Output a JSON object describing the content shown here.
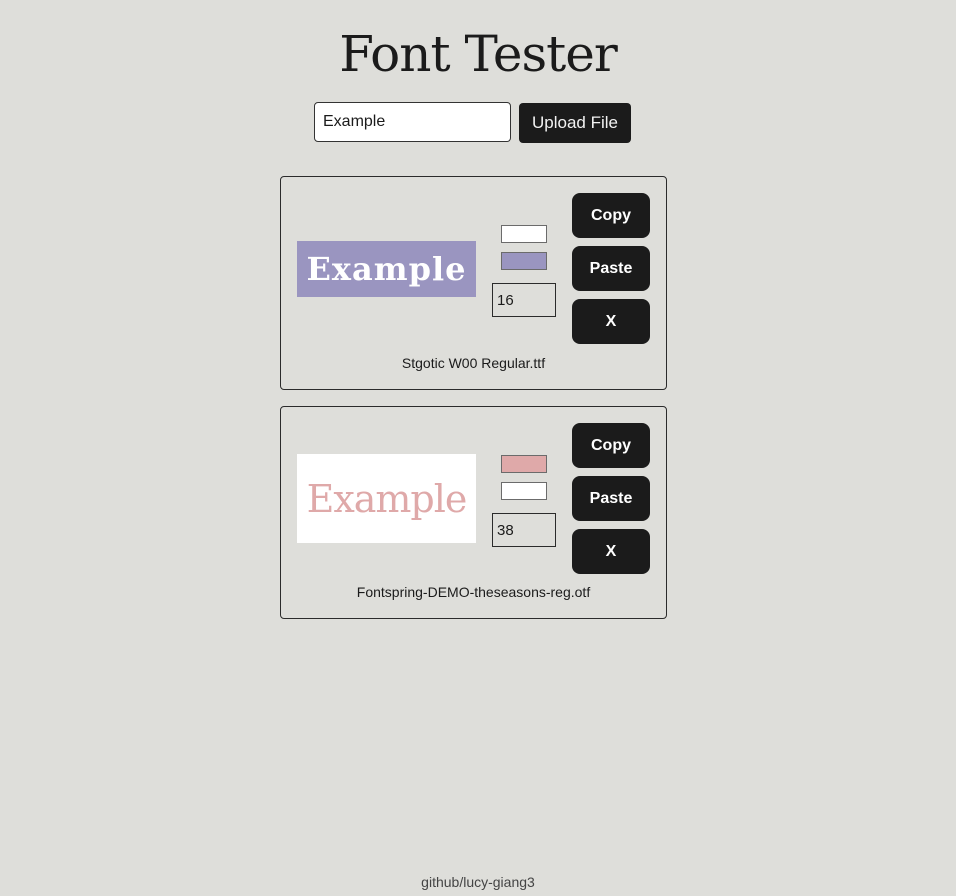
{
  "app": {
    "title": "Font Tester"
  },
  "controls": {
    "text_value": "Example",
    "upload_label": "Upload File"
  },
  "cards": [
    {
      "preview_text": "Example",
      "text_color": "#ffffff",
      "background_color": "#9a95c0",
      "font_size": "16",
      "filename": "Stgotic W00 Regular.ttf",
      "buttons": {
        "copy": "Copy",
        "paste": "Paste",
        "remove": "X"
      }
    },
    {
      "preview_text": "Example",
      "text_color": "#dfa9a9",
      "background_color": "#ffffff",
      "font_size": "38",
      "filename": "Fontspring-DEMO-theseasons-reg.otf",
      "buttons": {
        "copy": "Copy",
        "paste": "Paste",
        "remove": "X"
      }
    }
  ],
  "footer": {
    "link_text": "github/lucy-giang3"
  }
}
